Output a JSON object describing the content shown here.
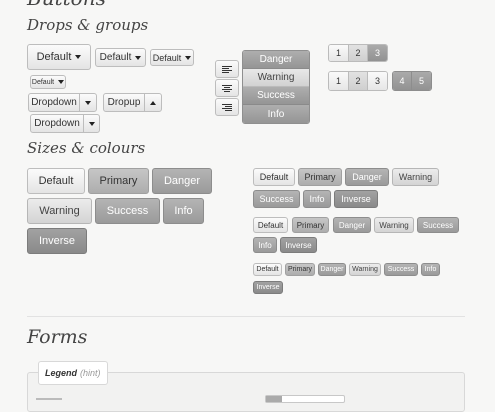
{
  "page": {
    "top_heading": "Buttons",
    "drops_heading": "Drops & groups",
    "sizes_heading": "Sizes & colours",
    "forms_heading": "Forms",
    "legend": "Legend",
    "legend_hint": "(hint)"
  },
  "drops": {
    "default_label": "Default",
    "dropdown_label": "Dropdown",
    "dropup_label": "Dropup"
  },
  "stack": [
    "Danger",
    "Warning",
    "Success",
    "Info"
  ],
  "pagers": {
    "first": [
      "1",
      "2",
      "3"
    ],
    "second": [
      "1",
      "2",
      "3",
      "4",
      "5"
    ]
  },
  "sizes_large": [
    "Default",
    "Primary",
    "Danger",
    "Warning",
    "Success",
    "Info",
    "Inverse"
  ],
  "sizes_small": [
    "Default",
    "Primary",
    "Danger",
    "Warning",
    "Success",
    "Info",
    "Inverse"
  ]
}
